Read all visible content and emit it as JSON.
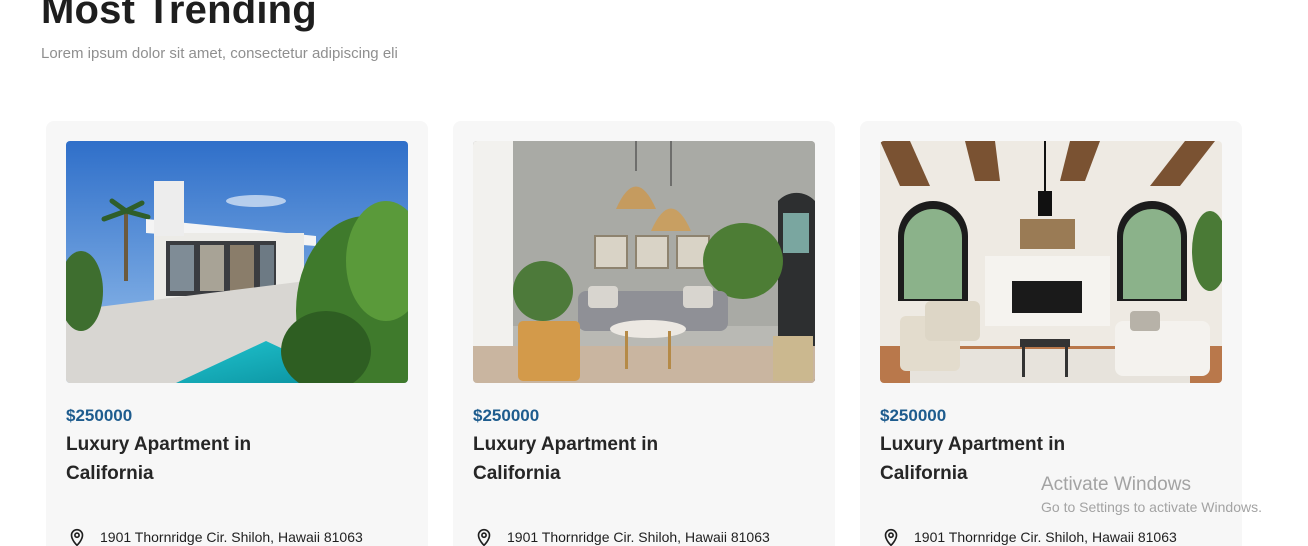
{
  "section": {
    "title": "Most Trending",
    "subtitle": "Lorem ipsum dolor sit amet, consectetur adipiscing eli"
  },
  "listings": [
    {
      "image": "modern-villa-pool-photo",
      "price": "$250000",
      "title": "Luxury Apartment in California",
      "address": "1901 Thornridge Cir. Shiloh, Hawaii 81063",
      "address_icon": "location-pin-icon"
    },
    {
      "image": "boho-living-room-photo",
      "price": "$250000",
      "title": "Luxury Apartment in California",
      "address": "1901 Thornridge Cir. Shiloh, Hawaii 81063",
      "address_icon": "location-pin-icon"
    },
    {
      "image": "beamed-living-room-photo",
      "price": "$250000",
      "title": "Luxury Apartment in California",
      "address": "1901 Thornridge Cir. Shiloh, Hawaii 81063",
      "address_icon": "location-pin-icon"
    }
  ],
  "watermark": {
    "line1": "Activate Windows",
    "line2": "Go to Settings to activate Windows."
  },
  "colors": {
    "price": "#1e5c8e",
    "card_background": "#f7f7f7",
    "heading": "#1e1e1e"
  }
}
